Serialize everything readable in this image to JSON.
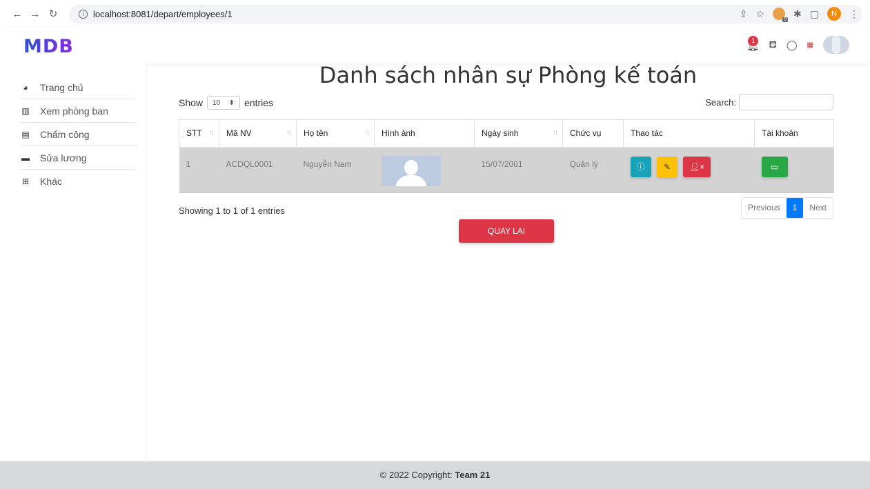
{
  "browser": {
    "url": "localhost:8081/depart/employees/1",
    "profile_initial": "N"
  },
  "header": {
    "logo": "MDB",
    "notification_count": "1"
  },
  "sidebar": {
    "items": [
      {
        "label": "Trang chủ",
        "icon": "dashboard-icon"
      },
      {
        "label": "Xem phòng ban",
        "icon": "building-icon"
      },
      {
        "label": "Chấm công",
        "icon": "calendar-icon"
      },
      {
        "label": "Sửa lương",
        "icon": "money-icon"
      },
      {
        "label": "Khác",
        "icon": "grid-icon"
      }
    ]
  },
  "main": {
    "title": "Danh sách nhân sự Phòng kế toán",
    "show_label": "Show",
    "entries_value": "10",
    "entries_label": "entries",
    "search_label": "Search:",
    "search_value": "",
    "columns": [
      "STT",
      "Mã NV",
      "Họ tên",
      "Hình ảnh",
      "Ngày sinh",
      "Chức vụ",
      "Thao tác",
      "Tài khoản"
    ],
    "rows": [
      {
        "stt": "1",
        "ma_nv": "ACDQL0001",
        "ho_ten": "Nguyễn Nam",
        "ngay_sinh": "15/07/2001",
        "chuc_vu": "Quản lý"
      }
    ],
    "showing_text": "Showing 1 to 1 of 1 entries",
    "pagination": {
      "previous": "Previous",
      "current": "1",
      "next": "Next"
    },
    "back_button": "QUAY LẠI"
  },
  "footer": {
    "copyright": "© 2022 Copyright: ",
    "team": "Team 21"
  }
}
